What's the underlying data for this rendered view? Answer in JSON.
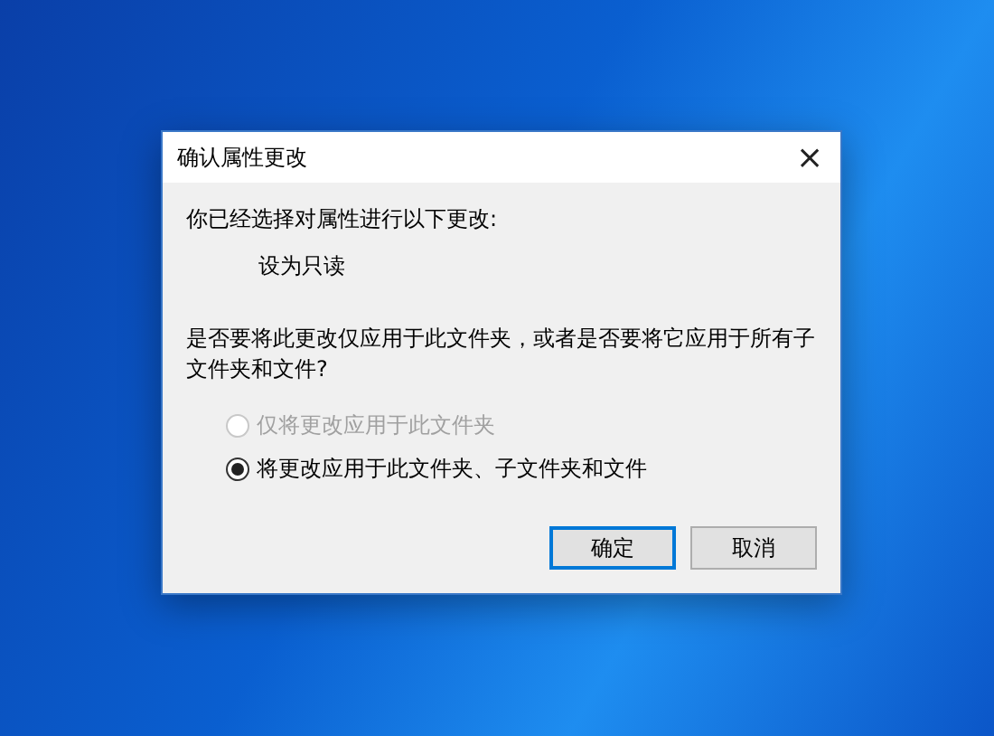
{
  "dialog": {
    "title": "确认属性更改",
    "close": "×",
    "intro": "你已经选择对属性进行以下更改:",
    "change": "设为只读",
    "question": "是否要将此更改仅应用于此文件夹，或者是否要将它应用于所有子文件夹和文件?",
    "options": [
      {
        "label": "仅将更改应用于此文件夹",
        "selected": false,
        "disabled": true
      },
      {
        "label": "将更改应用于此文件夹、子文件夹和文件",
        "selected": true,
        "disabled": false
      }
    ],
    "buttons": [
      {
        "label": "确定",
        "default": true
      },
      {
        "label": "取消",
        "default": false
      }
    ]
  }
}
